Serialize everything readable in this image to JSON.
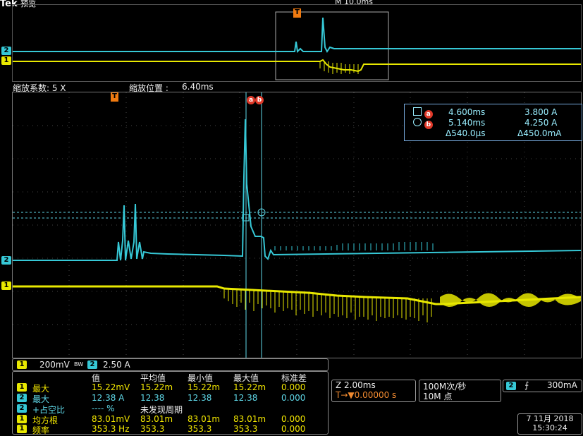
{
  "brand": {
    "logo": "Tek",
    "mode": "预览"
  },
  "header": {
    "timebase": "M 10.0ms"
  },
  "zoom": {
    "factor_label": "缩放系数: 5 X",
    "position_label": "缩放位置 :",
    "position_value": "6.40ms"
  },
  "markers": {
    "ch1": "1",
    "ch2": "2",
    "trigger": "T",
    "cursor_a": "a",
    "cursor_b": "b"
  },
  "cursor_readout": {
    "a_time": "4.600ms",
    "a_value": "3.800 A",
    "b_time": "5.140ms",
    "b_value": "4.250 A",
    "delta_time": "Δ540.0μs",
    "delta_value": "Δ450.0mA"
  },
  "scale": {
    "ch1_label": "1",
    "ch1_value": "200mV",
    "bw": "BW",
    "ch2_label": "2",
    "ch2_value": "2.50 A"
  },
  "measurements": {
    "headers": [
      "值",
      "平均值",
      "最小值",
      "最大值",
      "标准差"
    ],
    "rows": [
      {
        "ch": "1",
        "name": "最大",
        "value": "15.22mV",
        "mean": "15.22m",
        "min": "15.22m",
        "max": "15.22m",
        "std": "0.000",
        "color": "#f2e600"
      },
      {
        "ch": "2",
        "name": "最大",
        "value": "12.38 A",
        "mean": "12.38",
        "min": "12.38",
        "max": "12.38",
        "std": "0.000",
        "color": "#5fd8e8"
      },
      {
        "ch": "2",
        "name": "+占空比",
        "value": "---- %",
        "note": "未发现周期",
        "color": "#5fd8e8"
      },
      {
        "ch": "1",
        "name": "均方根",
        "value": "83.01mV",
        "mean": "83.01m",
        "min": "83.01m",
        "max": "83.01m",
        "std": "0.000",
        "color": "#f2e600"
      },
      {
        "ch": "1",
        "name": "频率",
        "value": "353.3 Hz",
        "mean": "353.3",
        "min": "353.3",
        "max": "353.3",
        "std": "0.000",
        "color": "#f2e600"
      }
    ]
  },
  "horizontal": {
    "zoom": "Z 2.00ms",
    "trig_pos": "T→▼0.00000 s"
  },
  "acquisition": {
    "rate": "100M次/秒",
    "points": "10M 点"
  },
  "trigger": {
    "source": "2",
    "slope": "⨍",
    "level": "300mA"
  },
  "datetime": {
    "date": "7 11月 2018",
    "time": "15:30:24"
  },
  "colors": {
    "ch1": "#f2e600",
    "ch2": "#36c8d6",
    "cursor": "#e03a2a",
    "trigger": "#f07a10"
  }
}
